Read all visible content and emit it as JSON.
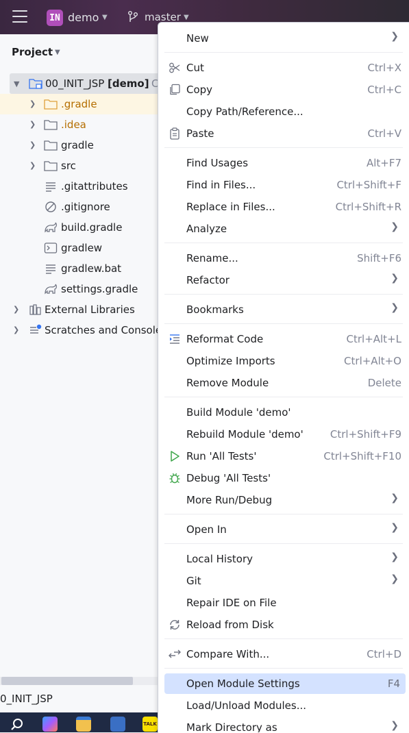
{
  "titlebar": {
    "project_badge": "IN",
    "project_name": "demo",
    "branch": "master"
  },
  "panel": {
    "title": "Project",
    "root_name": "00_INIT_JSP",
    "root_module": "[demo]",
    "root_suffix": "C",
    "items": [
      {
        "label": ".gradle",
        "kind": "folder"
      },
      {
        "label": ".idea",
        "kind": "folder"
      },
      {
        "label": "gradle",
        "kind": "folder"
      },
      {
        "label": "src",
        "kind": "folder"
      },
      {
        "label": ".gitattributes",
        "kind": "text-file"
      },
      {
        "label": ".gitignore",
        "kind": "ignore-file"
      },
      {
        "label": "build.gradle",
        "kind": "gradle-file"
      },
      {
        "label": "gradlew",
        "kind": "shell-file"
      },
      {
        "label": "gradlew.bat",
        "kind": "text-file"
      },
      {
        "label": "settings.gradle",
        "kind": "gradle-file"
      }
    ],
    "external_libraries": "External Libraries",
    "scratches": "Scratches and Consoles",
    "status_text": "0_INIT_JSP"
  },
  "menu": {
    "new": "New",
    "cut": "Cut",
    "cut_sc": "Ctrl+X",
    "copy": "Copy",
    "copy_sc": "Ctrl+C",
    "copy_path": "Copy Path/Reference...",
    "paste": "Paste",
    "paste_sc": "Ctrl+V",
    "find_usages": "Find Usages",
    "find_usages_sc": "Alt+F7",
    "find_in_files": "Find in Files...",
    "find_in_files_sc": "Ctrl+Shift+F",
    "replace_in_files": "Replace in Files...",
    "replace_in_files_sc": "Ctrl+Shift+R",
    "analyze": "Analyze",
    "rename": "Rename...",
    "rename_sc": "Shift+F6",
    "refactor": "Refactor",
    "bookmarks": "Bookmarks",
    "reformat": "Reformat Code",
    "reformat_sc": "Ctrl+Alt+L",
    "optimize": "Optimize Imports",
    "optimize_sc": "Ctrl+Alt+O",
    "remove_module": "Remove Module",
    "remove_module_sc": "Delete",
    "build_module": "Build Module 'demo'",
    "rebuild_module": "Rebuild Module 'demo'",
    "rebuild_module_sc": "Ctrl+Shift+F9",
    "run_tests": "Run 'All Tests'",
    "run_tests_sc": "Ctrl+Shift+F10",
    "debug_tests": "Debug 'All Tests'",
    "more_run": "More Run/Debug",
    "open_in": "Open In",
    "local_history": "Local History",
    "git": "Git",
    "repair_ide": "Repair IDE on File",
    "reload": "Reload from Disk",
    "compare": "Compare With...",
    "compare_sc": "Ctrl+D",
    "module_settings": "Open Module Settings",
    "module_settings_sc": "F4",
    "load_unload": "Load/Unload Modules...",
    "mark_dir": "Mark Directory as"
  },
  "colors": {
    "accent_purple": "#b04fba",
    "selection": "#d4e2ff",
    "run_green": "#3fa64b"
  }
}
